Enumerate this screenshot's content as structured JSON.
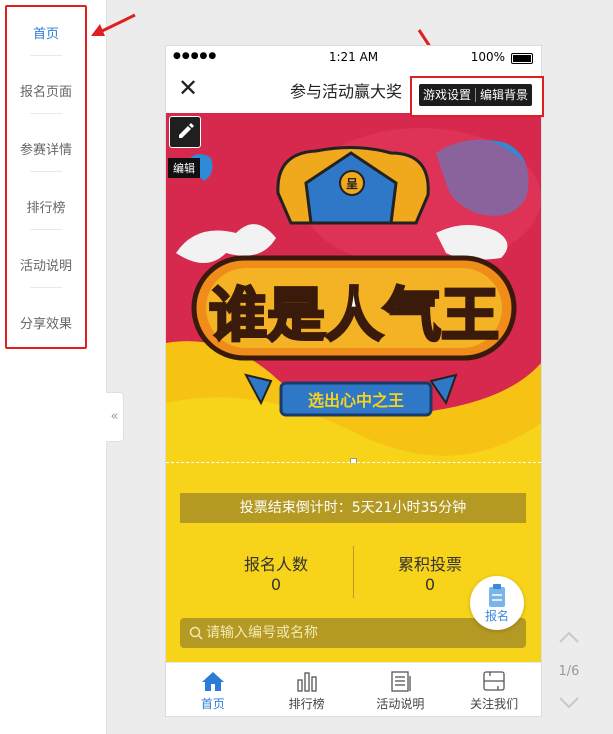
{
  "sidebar": {
    "items": [
      {
        "label": "首页"
      },
      {
        "label": "报名页面"
      },
      {
        "label": "参赛详情"
      },
      {
        "label": "排行榜"
      },
      {
        "label": "活动说明"
      },
      {
        "label": "分享效果"
      }
    ]
  },
  "collapse": {
    "label": "«"
  },
  "status_bar": {
    "signal": "●●●●●",
    "time": "1:21 AM",
    "battery": "100%"
  },
  "nav": {
    "close": "✕",
    "title": "参与活动赢大奖"
  },
  "toolbar": {
    "game_settings": "游戏设置",
    "edit_background": "编辑背景"
  },
  "banner": {
    "edit_label": "编辑",
    "headline": "谁是人气王",
    "ribbon": "选出心中之王",
    "crown_badge": "呈"
  },
  "stats": {
    "countdown": "投票结束倒计时：5天21小时35分钟",
    "signup_label": "报名人数",
    "signup_value": "0",
    "votes_label": "累积投票",
    "votes_value": "0"
  },
  "search": {
    "placeholder": "请输入编号或名称"
  },
  "signup_fab": {
    "label": "报名"
  },
  "tabbar": {
    "tabs": [
      {
        "label": "首页",
        "icon": "home-icon"
      },
      {
        "label": "排行榜",
        "icon": "bar-chart-icon"
      },
      {
        "label": "活动说明",
        "icon": "document-icon"
      },
      {
        "label": "关注我们",
        "icon": "follow-icon"
      }
    ]
  },
  "pager": {
    "text": "1/6"
  },
  "colors": {
    "accent_blue": "#2d7bd8",
    "annotation_red": "#e02020",
    "banner_red": "#d6294d",
    "banner_yellow": "#f7d31a",
    "dark_gold": "#b49a22"
  }
}
